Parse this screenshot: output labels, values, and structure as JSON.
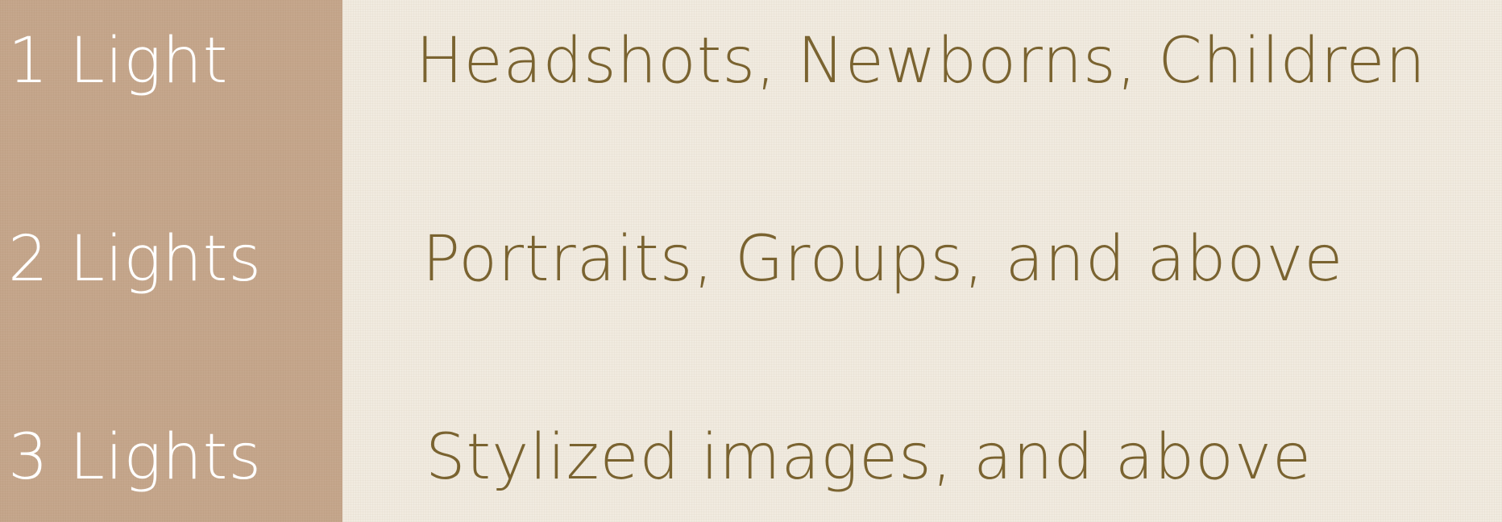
{
  "colors": {
    "left_panel": "#c4a58a",
    "background": "#f1ebe0",
    "label_text": "#ffffff",
    "description_text": "#7a6330"
  },
  "rows": [
    {
      "label": "1 Light",
      "description": "Headshots, Newborns, Children"
    },
    {
      "label": "2 Lights",
      "description": "Portraits, Groups, and above"
    },
    {
      "label": "3 Lights",
      "description": "Stylized images, and above"
    }
  ]
}
